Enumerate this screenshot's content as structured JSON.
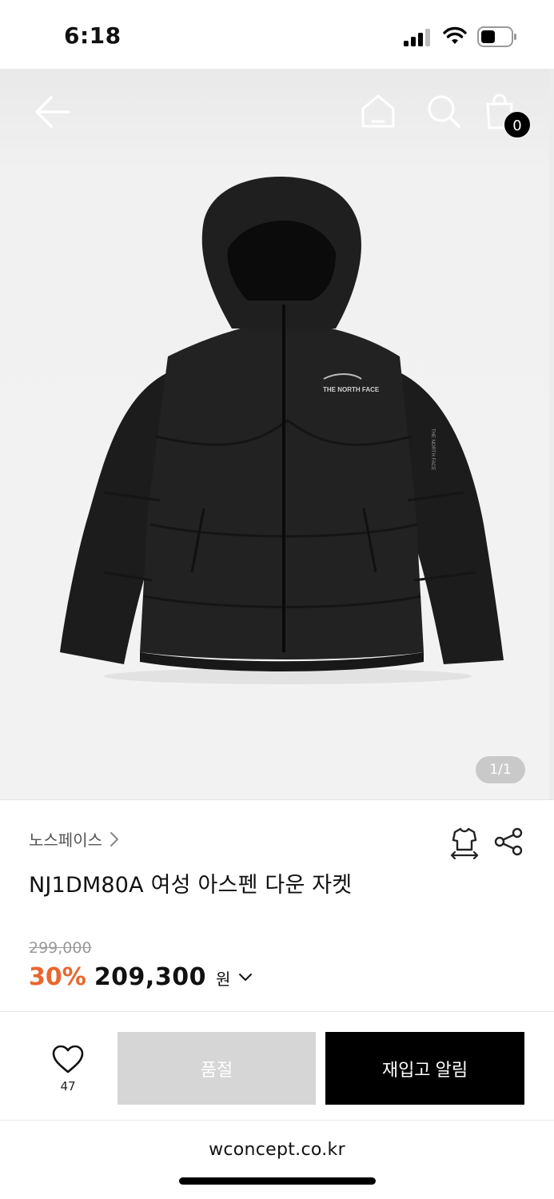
{
  "status_bar": {
    "time": "6:18"
  },
  "nav": {
    "cart_count": "0"
  },
  "gallery": {
    "counter": "1/1"
  },
  "product": {
    "brand": "노스페이스",
    "title": "NJ1DM80A 여성 아스펜 다운 자켓",
    "original_price": "299,000",
    "discount": "30%",
    "price": "209,300",
    "currency": "원",
    "logo_text": "THE NORTH FACE"
  },
  "actions": {
    "like_count": "47",
    "sold_out_label": "품절",
    "restock_label": "재입고 알림"
  },
  "browser": {
    "url": "wconcept.co.kr"
  },
  "colors": {
    "discount": "#e8672e",
    "sold_out_bg": "#d6d6d6",
    "primary_button": "#000000"
  },
  "icons": [
    "back-arrow-icon",
    "home-icon",
    "search-icon",
    "shopping-bag-icon",
    "size-guide-icon",
    "share-icon",
    "heart-icon",
    "chevron-right-icon",
    "chevron-down-icon"
  ]
}
